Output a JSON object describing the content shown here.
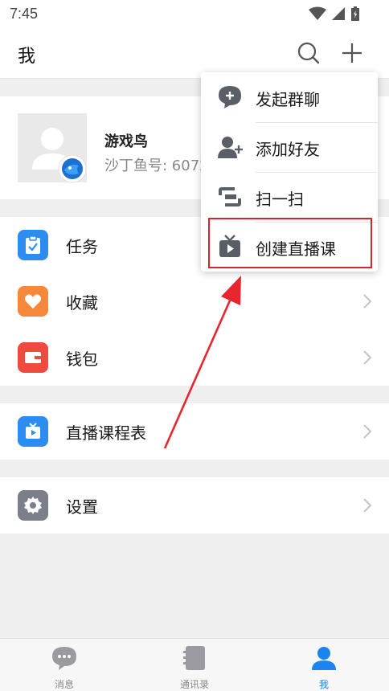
{
  "status_bar": {
    "time": "7:45"
  },
  "header": {
    "title": "我"
  },
  "profile": {
    "name": "游戏鸟",
    "id_text": "沙丁鱼号: 6072"
  },
  "menu": {
    "tasks": "任务",
    "favorites": "收藏",
    "wallet": "钱包",
    "live_schedule": "直播课程表",
    "settings": "设置"
  },
  "popup": {
    "items": [
      "发起群聊",
      "添加好友",
      "扫一扫",
      "创建直播课"
    ]
  },
  "tabbar": {
    "tabs": [
      "消息",
      "通讯录",
      "我"
    ],
    "active": "我"
  },
  "colors": {
    "accent_blue": "#1c83f0",
    "task_blue": "#2d8cf0",
    "favorite_orange": "#f5883a",
    "wallet_red": "#f0493d",
    "settings_gray": "#7b7f8a",
    "highlight_red": "#d9232e"
  }
}
